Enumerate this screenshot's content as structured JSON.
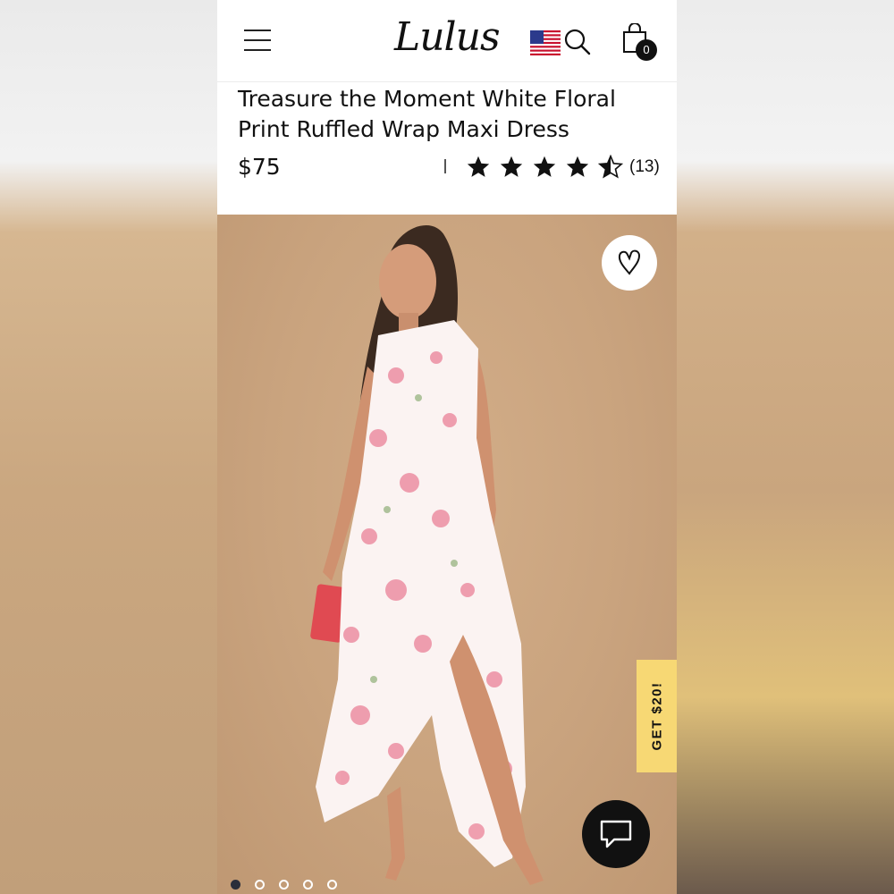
{
  "header": {
    "logo_text": "Lulus",
    "cart_count": "0",
    "flag_icon": "us-flag-icon",
    "search_icon": "search-icon",
    "cart_icon": "shopping-bag-icon",
    "menu_icon": "hamburger-menu-icon"
  },
  "product": {
    "title": "Treasure the Moment White Floral Print Ruffled Wrap Maxi Dress",
    "price": "$75",
    "rating": 4.5,
    "review_count": "(13)"
  },
  "gallery": {
    "image_count": 5,
    "active_index": 0,
    "wishlist_icon": "heart-icon",
    "chat_icon": "chat-icon"
  },
  "promo": {
    "tab_label": "GET $20!",
    "color": "#f7d874"
  }
}
